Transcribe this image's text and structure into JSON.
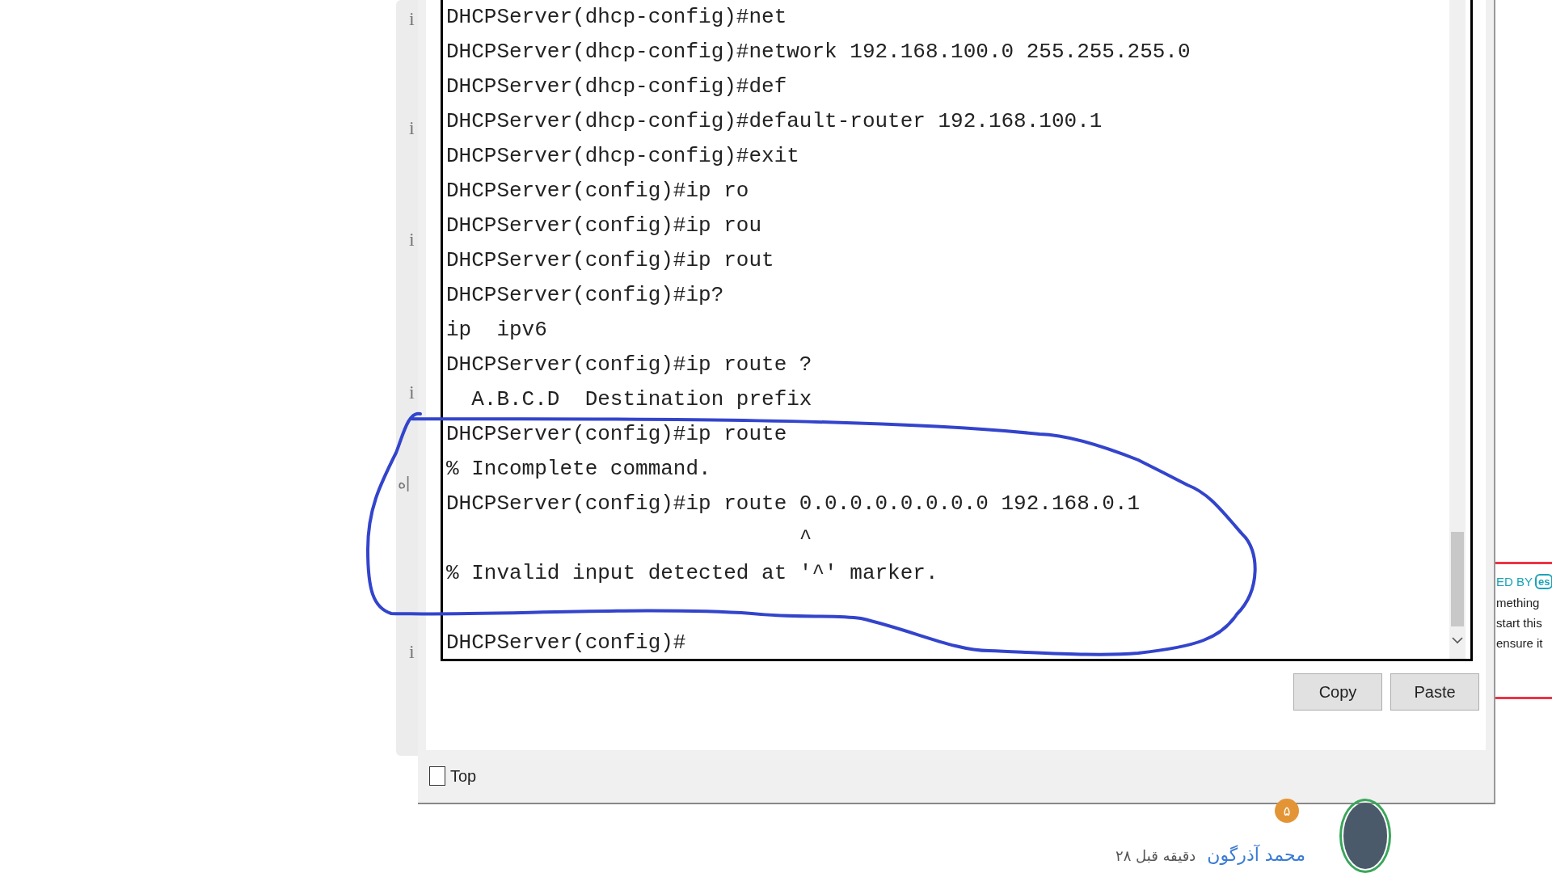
{
  "background_left": {
    "markers": [
      "i",
      "i",
      "i",
      "i",
      "i"
    ],
    "label": "ه|"
  },
  "terminal": {
    "lines": [
      {
        "kind": "text",
        "text": "DHCPServer(dhcp-config)#net"
      },
      {
        "kind": "text",
        "text": "DHCPServer(dhcp-config)#network 192.168.100.0 255.255.255.0"
      },
      {
        "kind": "text",
        "text": "DHCPServer(dhcp-config)#def"
      },
      {
        "kind": "text",
        "text": "DHCPServer(dhcp-config)#default-router 192.168.100.1"
      },
      {
        "kind": "text",
        "text": "DHCPServer(dhcp-config)#exit"
      },
      {
        "kind": "text",
        "text": "DHCPServer(config)#ip ro"
      },
      {
        "kind": "text",
        "text": "DHCPServer(config)#ip rou"
      },
      {
        "kind": "text",
        "text": "DHCPServer(config)#ip rout"
      },
      {
        "kind": "text",
        "text": "DHCPServer(config)#ip?"
      },
      {
        "kind": "text",
        "text": "ip  ipv6"
      },
      {
        "kind": "text",
        "text": "DHCPServer(config)#ip route ?"
      },
      {
        "kind": "text",
        "text": "  A.B.C.D  Destination prefix"
      },
      {
        "kind": "text",
        "text": "DHCPServer(config)#ip route"
      },
      {
        "kind": "text",
        "text": "% Incomplete command."
      },
      {
        "kind": "text",
        "text": "DHCPServer(config)#ip route 0.0.0.0.0.0.0.0 192.168.0.1"
      },
      {
        "kind": "text",
        "text": "                            ^"
      },
      {
        "kind": "text",
        "text": "% Invalid input detected at '^' marker."
      },
      {
        "kind": "blank"
      },
      {
        "kind": "text",
        "text": "DHCPServer(config)#"
      }
    ]
  },
  "buttons": [
    "Copy",
    "Paste"
  ],
  "top_checkbox": {
    "label": "Top",
    "checked": false
  },
  "security_popup": {
    "heading": "ED BY",
    "logo": "es",
    "lines": [
      "mething",
      "start this",
      "ensure it"
    ]
  },
  "comment": {
    "badge": "۵",
    "author": "محمد آذرگون",
    "time": "۲۸ دقیقه قبل"
  }
}
